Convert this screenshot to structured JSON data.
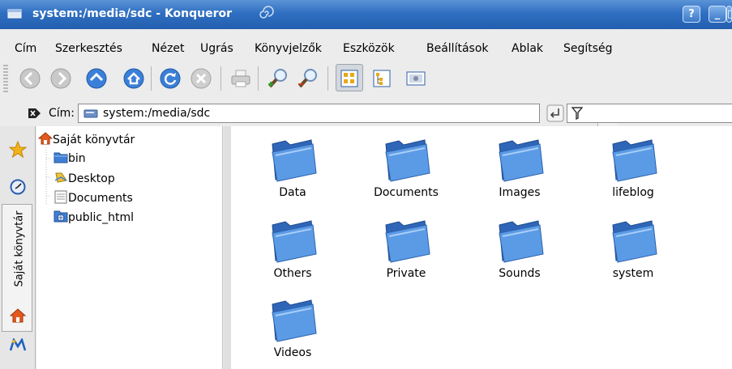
{
  "window": {
    "title": "system:/media/sdc - Konqueror"
  },
  "window_buttons": [
    "?",
    "_",
    "□"
  ],
  "menu": [
    "Cím",
    "Szerkesztés",
    "Nézet",
    "Ugrás",
    "Könyvjelzők",
    "Eszközök",
    "Beállítások",
    "Ablak",
    "Segítség"
  ],
  "toolbar": [
    "back-icon",
    "forward-icon",
    "up-icon",
    "home-icon",
    "reload-icon",
    "stop-icon",
    "print-icon",
    "zoom-in-icon",
    "zoom-out-icon",
    "icon-view-icon",
    "tree-view-icon",
    "preview-icon"
  ],
  "location": {
    "label": "Cím:",
    "value": "system:/media/sdc"
  },
  "sidebar": {
    "tab_label": "Saját könyvtár"
  },
  "tree": {
    "root": "Saját könyvtár",
    "children": [
      "bin",
      "Desktop",
      "Documents",
      "public_html"
    ]
  },
  "folders": [
    "Data",
    "Documents",
    "Images",
    "lifeblog",
    "Others",
    "Private",
    "Sounds",
    "system",
    "Videos"
  ],
  "colors": {
    "title_bar": "#2f6fc2",
    "folder_blue": "#3f7fd4"
  }
}
